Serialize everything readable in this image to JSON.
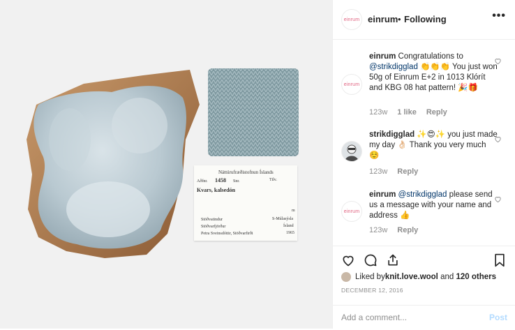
{
  "post": {
    "username": "einrum",
    "separator": "•",
    "follow_status": "Following",
    "more": "•••",
    "avatar_text": "einrum"
  },
  "photo_label": {
    "institute": "Náttúrufræðistofnun Íslands",
    "reg_label": "Aðfnr.",
    "reg_number": "1458",
    "snr_label": "Snr.",
    "til_label": "Tilv.",
    "name": "Kvars, kalsedón",
    "m": "m",
    "place": "Stöðvatindur",
    "region": "S-Múlasýsla",
    "district": "Stöðvarfjörður",
    "country": "Ísland",
    "collector": "Petra Sveinsdóttir, Stöðvarfirði",
    "year": "1965"
  },
  "comments": [
    {
      "user": "einrum",
      "avatar_text": "einrum",
      "text_pre": "Congratulations to ",
      "mention": "@strikdigglad",
      "text_post": " 👏👏👏 You just won 50g of Einrum E+2 in 1013 Klórít and KBG 08 hat pattern! 🎉🎁",
      "age": "123w",
      "likes": "1 like",
      "reply": "Reply"
    },
    {
      "user": "strikdigglad",
      "text_pre": "",
      "mention": "",
      "text_post": "✨😍✨ you just made my day 👌🏻 Thank you very much ☺️",
      "age": "123w",
      "likes": "",
      "reply": "Reply"
    },
    {
      "user": "einrum",
      "avatar_text": "einrum",
      "text_pre": "",
      "mention": "@strikdigglad",
      "text_post": " please send us a message with your name and address 👍",
      "age": "123w",
      "likes": "",
      "reply": "Reply"
    }
  ],
  "liked": {
    "prefix": "Liked by ",
    "user": "knit.love.wool",
    "and": " and ",
    "others": "120 others"
  },
  "date": "DECEMBER 12, 2016",
  "add_comment": {
    "placeholder": "Add a comment...",
    "post": "Post"
  },
  "colors": {
    "mention": "#003569",
    "meta": "#8e8e8e",
    "brand_pink": "#e0607e",
    "post_disabled": "#b3dbff"
  }
}
